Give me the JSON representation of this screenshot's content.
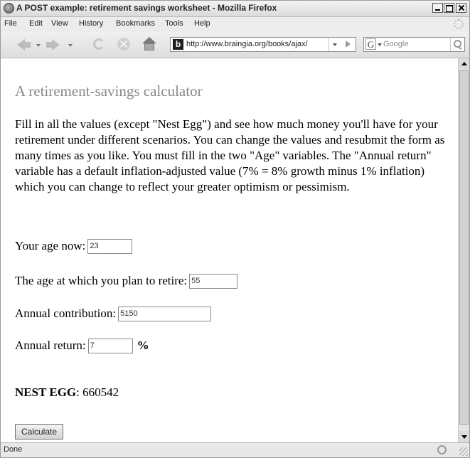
{
  "window": {
    "title": "A POST example: retirement savings worksheet - Mozilla Firefox"
  },
  "menu": [
    "File",
    "Edit",
    "View",
    "History",
    "Bookmarks",
    "Tools",
    "Help"
  ],
  "nav": {
    "url": "http://www.braingia.org/books/ajax/",
    "search_placeholder": "Google",
    "search_engine_glyph": "G",
    "site_icon_glyph": "b"
  },
  "page": {
    "title": "A retirement-savings calculator",
    "intro": "Fill in all the values (except \"Nest Egg\") and see how much money you'll have for your retirement under different scenarios. You can change the values and resubmit the form as many times as you like. You must fill in the two \"Age\" variables. The \"Annual return\" variable has a default inflation-adjusted value (7% = 8% growth minus 1% inflation) which you can change to reflect your greater optimism or pessimism.",
    "fields": {
      "age_now": {
        "label": "Your age now:",
        "value": "23"
      },
      "retire_age": {
        "label": "The age at which you plan to retire:",
        "value": "55"
      },
      "contribution": {
        "label": "Annual contribution:",
        "value": "5150"
      },
      "annual_return": {
        "label": "Annual return:",
        "value": "7",
        "suffix": "%"
      }
    },
    "nest_egg": {
      "label": "NEST EGG",
      "separator": ":",
      "value": "660542"
    },
    "calculate_label": "Calculate"
  },
  "status": {
    "text": "Done"
  }
}
